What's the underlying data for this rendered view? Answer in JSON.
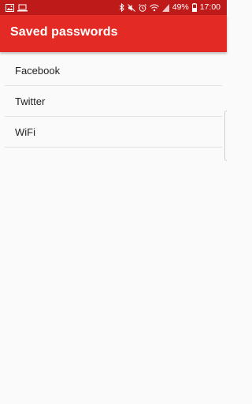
{
  "status_bar": {
    "left_icons": [
      "image-notification-icon",
      "laptop-notification-icon"
    ],
    "right_icons": [
      "bluetooth-icon",
      "mute-icon",
      "alarm-icon",
      "wifi-icon",
      "signal-icon",
      "battery-icon"
    ],
    "battery_percent": "49%",
    "time": "17:00"
  },
  "app_bar": {
    "title": "Saved passwords"
  },
  "list": {
    "items": [
      {
        "label": "Facebook"
      },
      {
        "label": "Twitter"
      },
      {
        "label": "WiFi"
      }
    ]
  },
  "colors": {
    "status_bar": "#bf1a1a",
    "app_bar": "#e42a24",
    "background": "#fafafa",
    "divider": "#e2e2e2",
    "text": "#222222"
  }
}
